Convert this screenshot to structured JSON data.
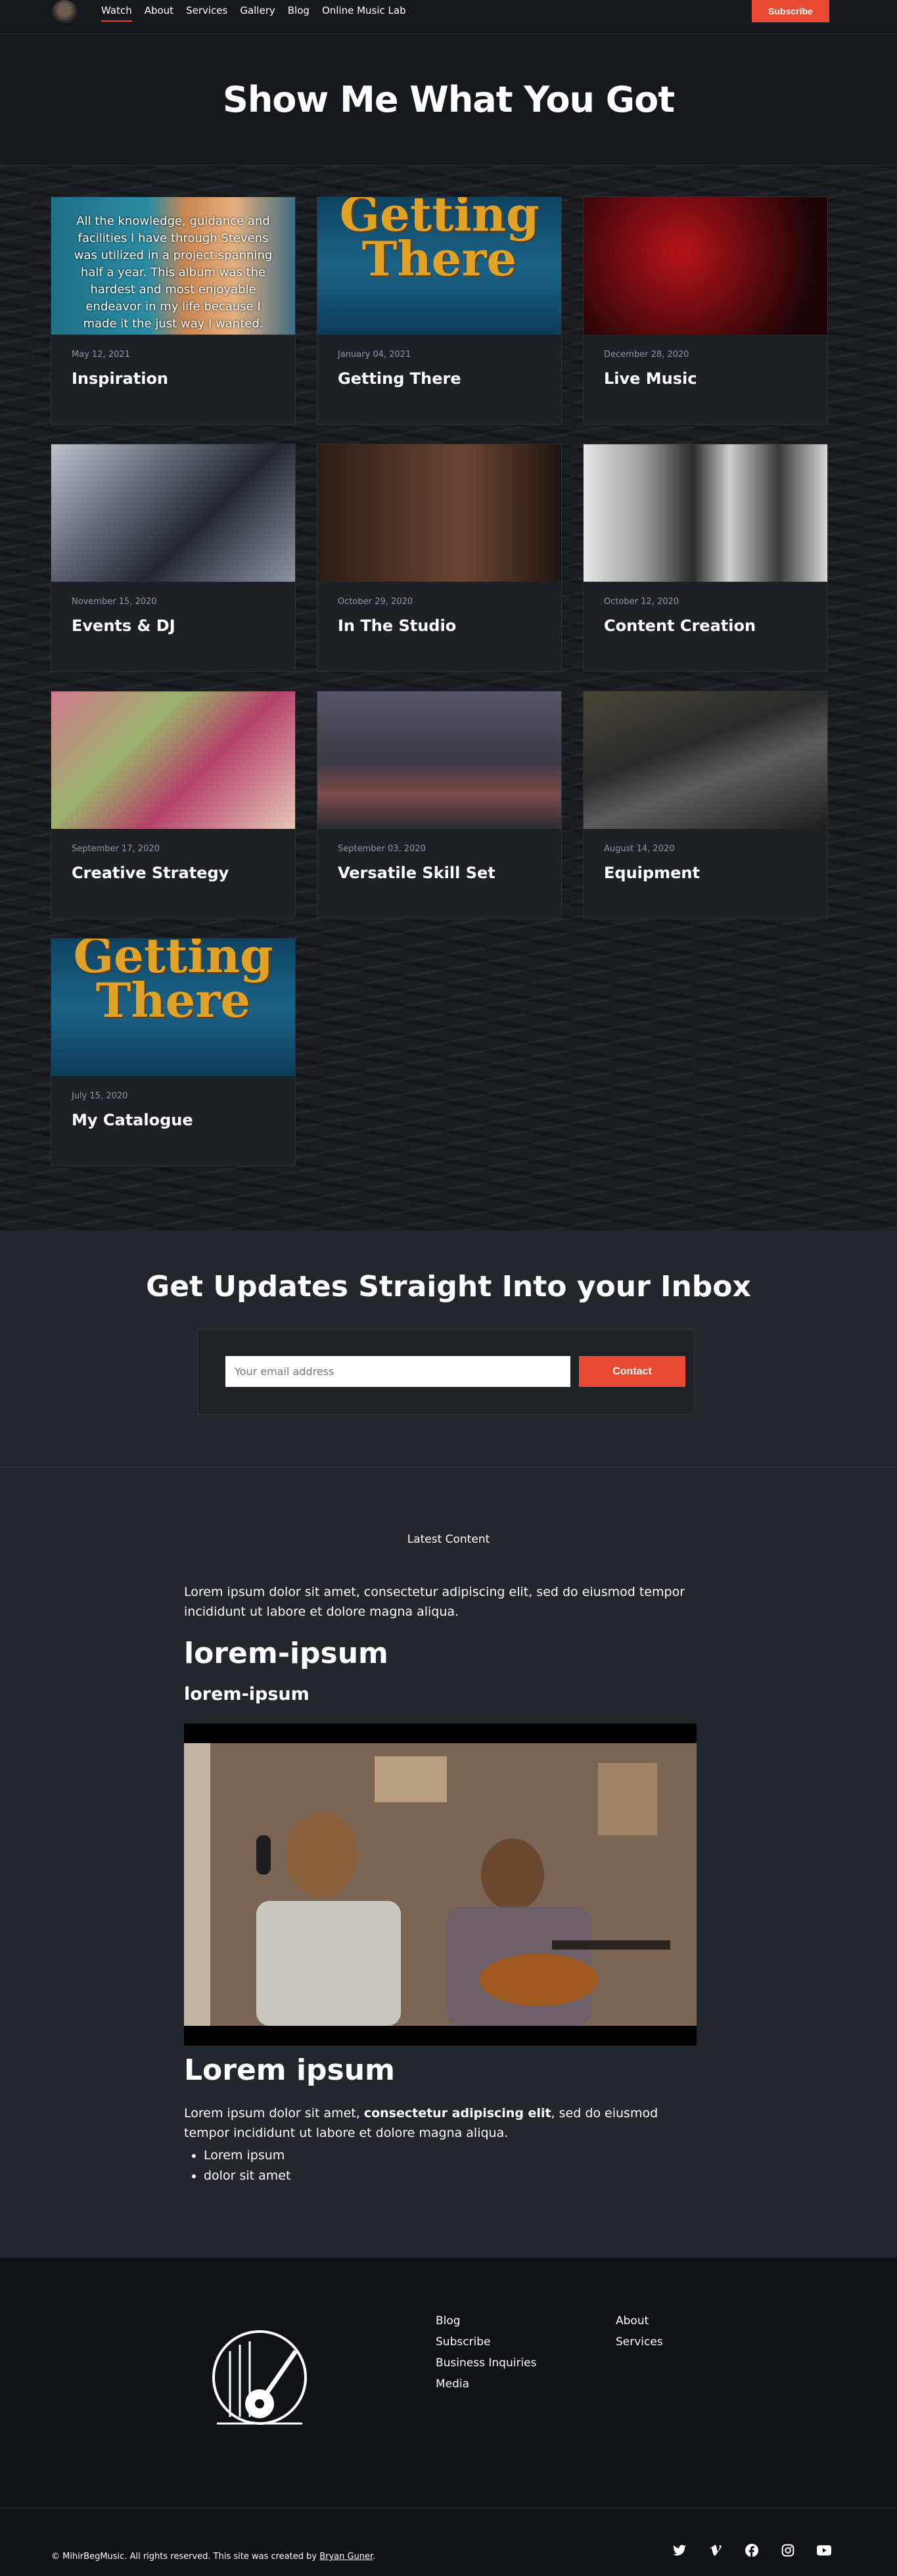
{
  "nav": {
    "items": [
      "Watch",
      "About",
      "Services",
      "Gallery",
      "Blog",
      "Online Music Lab"
    ],
    "subscribe": "Subscribe"
  },
  "hero": {
    "title": "Show Me What You Got"
  },
  "cards": [
    {
      "date": "May 12, 2021",
      "title": "Inspiration",
      "overlay": "All the knowledge, guidance and facilities I have through Stevens was utilized in a project spanning half a year. This album was the hardest and most enjoyable endeavor in my life because I made it the just way I wanted."
    },
    {
      "date": "January 04, 2021",
      "title": "Getting There",
      "art": "Getting There"
    },
    {
      "date": "December 28, 2020",
      "title": "Live Music"
    },
    {
      "date": "November 15, 2020",
      "title": "Events & DJ"
    },
    {
      "date": "October 29, 2020",
      "title": "In The Studio"
    },
    {
      "date": "October 12, 2020",
      "title": "Content Creation"
    },
    {
      "date": "September 17, 2020",
      "title": "Creative Strategy"
    },
    {
      "date": "September 03, 2020",
      "title": "Versatile Skill Set"
    },
    {
      "date": "August 14, 2020",
      "title": "Equipment"
    },
    {
      "date": "July 15, 2020",
      "title": "My Catalogue",
      "art": "Getting There"
    }
  ],
  "newsletter": {
    "title": "Get Updates Straight Into your Inbox",
    "placeholder": "Your email address",
    "button": "Contact"
  },
  "content": {
    "heading": "Latest Content",
    "para1": "Lorem ipsum dolor sit amet, consectetur adipiscing elit, sed do eiusmod tempor incididunt ut labore et dolore magna aliqua.",
    "h1": "lorem-ipsum",
    "h2": "lorem-ipsum",
    "h3": "Lorem ipsum",
    "para2_start": "Lorem ipsum dolor sit amet, ",
    "para2_bold": "consectetur adipiscing elit",
    "para2_end": ", sed do eiusmod tempor incididunt ut labore et dolore magna aliqua.",
    "list": [
      "Lorem ipsum",
      "dolor sit amet"
    ]
  },
  "footer": {
    "col1": [
      "Blog",
      "Subscribe",
      "Business Inquiries",
      "Media"
    ],
    "col2": [
      "About",
      "Services"
    ],
    "copyright": "© MihirBegMusic. All rights reserved. This site was created by ",
    "creator": "Bryan Guner",
    "period": ".",
    "socials": [
      "twitter-icon",
      "vimeo-icon",
      "facebook-icon",
      "instagram-icon",
      "youtube-icon"
    ]
  }
}
